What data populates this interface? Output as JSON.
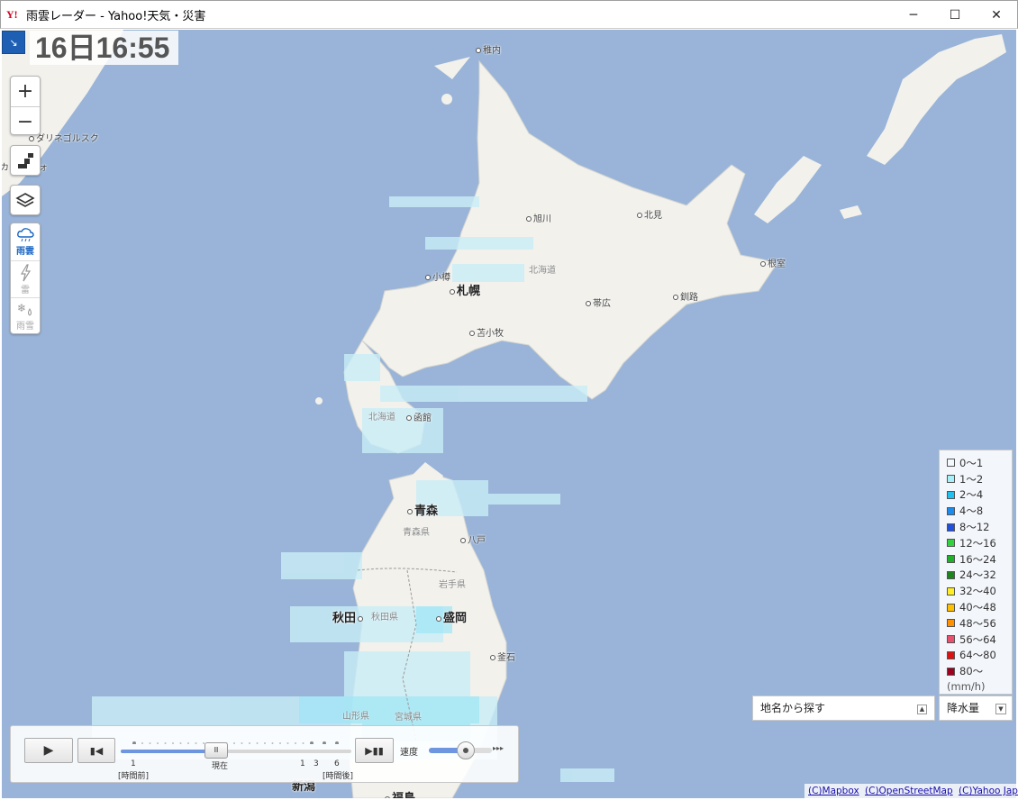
{
  "window": {
    "title": "雨雲レーダー - Yahoo!天気・災害",
    "app_icon": "Y!",
    "minimize": "─",
    "maximize": "☐",
    "close": "✕"
  },
  "timestamp": "16日16:55",
  "controls": {
    "zoom_in": "+",
    "zoom_out": "−",
    "modes": [
      {
        "label": "雨雲",
        "icon": "cloud-rain-icon",
        "active": true
      },
      {
        "label": "雷",
        "icon": "lightning-icon",
        "active": false
      },
      {
        "label": "雨雪",
        "icon": "snow-rain-icon",
        "active": false
      }
    ]
  },
  "places": {
    "wakkanai": "稚内",
    "asahikawa": "旭川",
    "kitami": "北見",
    "nemuro": "根室",
    "otaru": "小樽",
    "sapporo": "札幌",
    "hokkaido": "北海道",
    "obihiro": "帯広",
    "kushiro": "釧路",
    "tomakomai": "苫小牧",
    "hokkaido2": "北海道",
    "hakodate": "函館",
    "aomori": "青森",
    "aomori_pref": "青森県",
    "hachinohe": "八戸",
    "iwate_pref": "岩手県",
    "akita": "秋田",
    "akita_pref": "秋田県",
    "morioka": "盛岡",
    "kamaishi": "釜石",
    "yamagata_pref": "山形県",
    "miyagi_pref": "宮城県",
    "niigata": "新潟",
    "fukushima": "福島",
    "dalnegorsk": "ダリネゴルスク",
    "kavalerovo": "カ  ーロヴォ"
  },
  "legend": {
    "items": [
      {
        "label": "0〜1",
        "color": "#f2fafe"
      },
      {
        "label": "1〜2",
        "color": "#a6f0f8"
      },
      {
        "label": "2〜4",
        "color": "#21c1ef"
      },
      {
        "label": "4〜8",
        "color": "#1a8cf0"
      },
      {
        "label": "8〜12",
        "color": "#2150e0"
      },
      {
        "label": "12〜16",
        "color": "#32d23e"
      },
      {
        "label": "16〜24",
        "color": "#22b02a"
      },
      {
        "label": "24〜32",
        "color": "#1e8420"
      },
      {
        "label": "32〜40",
        "color": "#ffee22"
      },
      {
        "label": "40〜48",
        "color": "#ffc000"
      },
      {
        "label": "48〜56",
        "color": "#ff9000"
      },
      {
        "label": "56〜64",
        "color": "#e8506e"
      },
      {
        "label": "64〜80",
        "color": "#e01010"
      },
      {
        "label": "80〜",
        "color": "#a00020"
      }
    ],
    "unit": "(mm/h)"
  },
  "search": {
    "label": "地名から探す",
    "arrow": "▲"
  },
  "precip": {
    "label": "降水量",
    "arrow": "▼"
  },
  "player": {
    "play": "▶",
    "step_back": "▮◀",
    "play_pause": "▶▮▮",
    "label_1": "1",
    "label_before": "[時間前]",
    "label_now": "現在",
    "label_1b": "1",
    "label_3": "3",
    "label_6": "6",
    "label_after": "[時間後]",
    "speed": "速度",
    "speed_arrows": "▸▸▸",
    "position_fraction": 0.42
  },
  "attribution": [
    "(C)Mapbox",
    "(C)OpenStreetMap",
    "(C)Yahoo Japan"
  ]
}
